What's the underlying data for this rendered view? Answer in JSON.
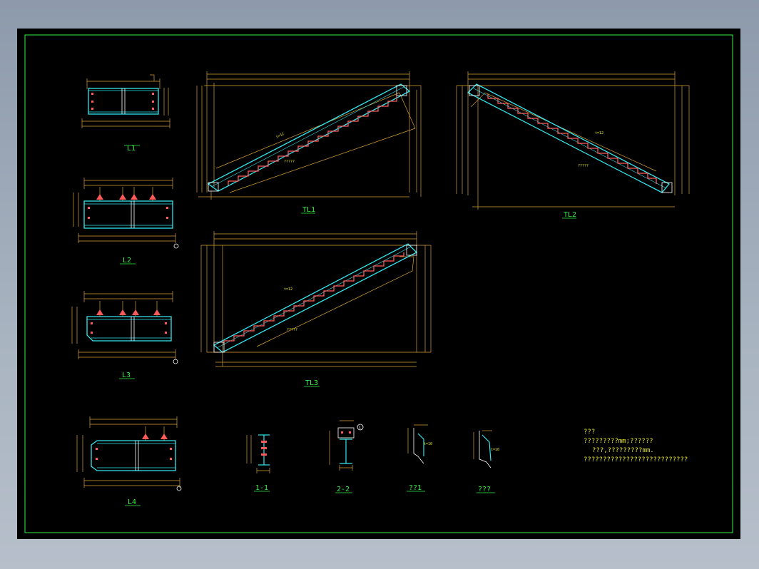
{
  "colors": {
    "background": "#000000",
    "frame": "#33ee44",
    "dimension": "#d9a233",
    "steel": "#33e6ee",
    "step": "#ff5a5a",
    "text_green": "#33ee44",
    "text_yellow": "#e7e72a"
  },
  "titles": {
    "L1": "L1",
    "L2": "L2",
    "L3": "L3",
    "L4": "L4",
    "TL1": "TL1",
    "TL2": "TL2",
    "TL3": "TL3",
    "sec11": "1-1",
    "sec22": "2-2",
    "node1": "??1",
    "node2": "???"
  },
  "labels": {
    "t10": "t=10",
    "t12": "t=12",
    "note_ref": "?????",
    "section_marker": "1"
  },
  "notes": {
    "title": "???",
    "line1": "?????????mm;??????",
    "line2": "???,?????????mm.",
    "line3": "???????????????????????????"
  }
}
